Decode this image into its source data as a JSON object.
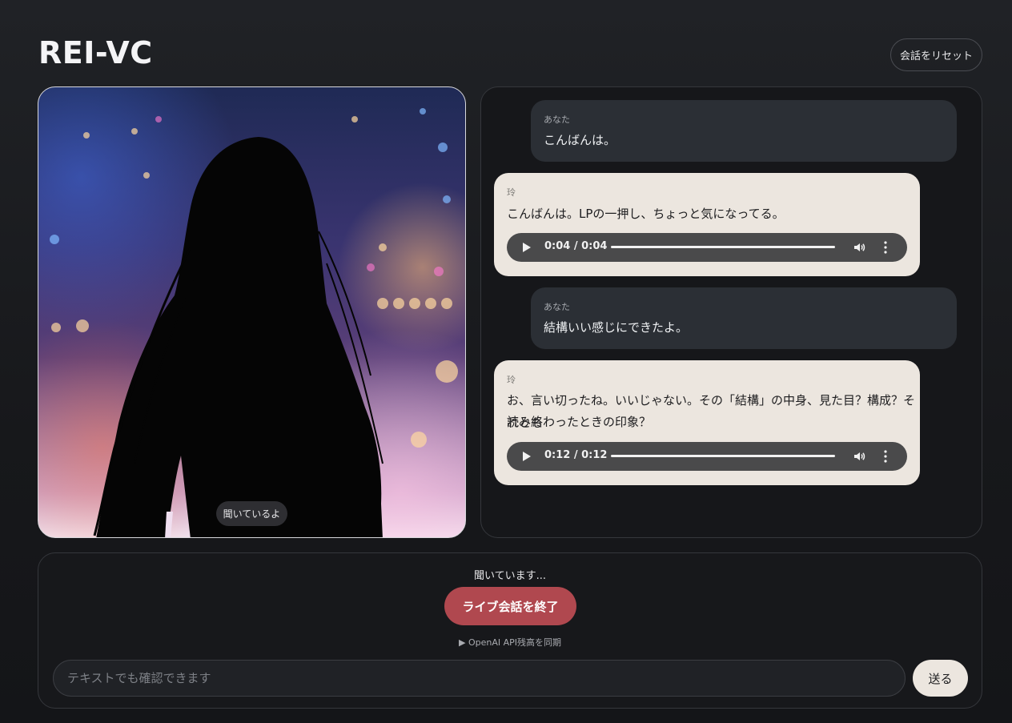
{
  "app": {
    "title": "REI-VC",
    "reset_label": "会話をリセット"
  },
  "avatar": {
    "status_label": "聞いているよ"
  },
  "chat": {
    "messages": [
      {
        "speaker": "あなた",
        "text": "こんばんは。"
      },
      {
        "speaker": "玲",
        "text": "こんばんは。LPの一押し、ちょっと気になってる。",
        "audio_time": "0:04 / 0:04"
      },
      {
        "speaker": "あなた",
        "text": "結構いい感じにできたよ。"
      },
      {
        "speaker": "玲",
        "text_line1": "お、言い切ったね。いいじゃない。その「結構」の中身、見た目？構成？それとも",
        "text_line2": "読み終わったときの印象？",
        "audio_time": "0:12 / 0:12"
      }
    ]
  },
  "controls": {
    "status_text": "聞いています...",
    "end_button_label": "ライブ会話を終了",
    "sync_label": "▶ OpenAI API残高を同期",
    "input_placeholder": "テキストでも確認できます",
    "send_label": "送る"
  },
  "colors": {
    "end_button": "#b0484f",
    "ai_bubble": "#ece6df",
    "user_bubble": "#2b2f35"
  },
  "icons": {
    "play": "play-icon",
    "volume": "volume-icon",
    "more": "more-vertical-icon"
  }
}
